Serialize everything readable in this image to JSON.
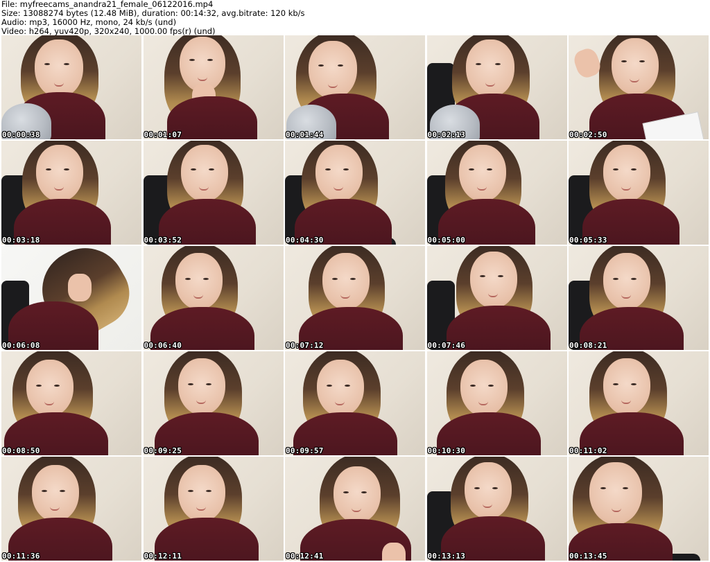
{
  "header": {
    "file_line": "File: myfreecams_anandra21_female_06122016.mp4",
    "size_line": "Size: 13088274 bytes (12.48 MiB), duration: 00:14:32, avg.bitrate: 120 kb/s",
    "audio_line": "Audio: mp3, 16000 Hz, mono, 24 kb/s (und)",
    "video_line": "Video: h264, yuv420p, 320x240, 1000.00 fps(r) (und)"
  },
  "thumbnails": [
    {
      "timestamp": "00:00:38"
    },
    {
      "timestamp": "00:01:07"
    },
    {
      "timestamp": "00:01:44"
    },
    {
      "timestamp": "00:02:13"
    },
    {
      "timestamp": "00:02:50"
    },
    {
      "timestamp": "00:03:18"
    },
    {
      "timestamp": "00:03:52"
    },
    {
      "timestamp": "00:04:30"
    },
    {
      "timestamp": "00:05:00"
    },
    {
      "timestamp": "00:05:33"
    },
    {
      "timestamp": "00:06:08"
    },
    {
      "timestamp": "00:06:40"
    },
    {
      "timestamp": "00:07:12"
    },
    {
      "timestamp": "00:07:46"
    },
    {
      "timestamp": "00:08:21"
    },
    {
      "timestamp": "00:08:50"
    },
    {
      "timestamp": "00:09:25"
    },
    {
      "timestamp": "00:09:57"
    },
    {
      "timestamp": "00:10:30"
    },
    {
      "timestamp": "00:11:02"
    },
    {
      "timestamp": "00:11:36"
    },
    {
      "timestamp": "00:12:11"
    },
    {
      "timestamp": "00:12:41"
    },
    {
      "timestamp": "00:13:13"
    },
    {
      "timestamp": "00:13:45"
    }
  ]
}
